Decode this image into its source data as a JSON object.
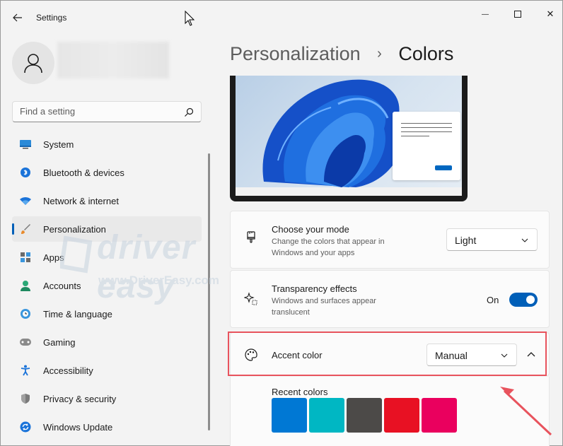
{
  "window": {
    "title": "Settings",
    "minimize_glyph": "—",
    "close_glyph": "✕"
  },
  "search": {
    "placeholder": "Find a setting"
  },
  "sidebar": {
    "items": [
      {
        "label": "System",
        "icon": "system-icon"
      },
      {
        "label": "Bluetooth & devices",
        "icon": "bluetooth-icon"
      },
      {
        "label": "Network & internet",
        "icon": "wifi-icon"
      },
      {
        "label": "Personalization",
        "icon": "brush-icon",
        "active": true
      },
      {
        "label": "Apps",
        "icon": "apps-icon"
      },
      {
        "label": "Accounts",
        "icon": "person-icon"
      },
      {
        "label": "Time & language",
        "icon": "globe-clock-icon"
      },
      {
        "label": "Gaming",
        "icon": "gamepad-icon"
      },
      {
        "label": "Accessibility",
        "icon": "accessibility-icon"
      },
      {
        "label": "Privacy & security",
        "icon": "shield-icon"
      },
      {
        "label": "Windows Update",
        "icon": "update-icon"
      }
    ]
  },
  "breadcrumb": {
    "parent": "Personalization",
    "separator": "›",
    "current": "Colors"
  },
  "settings": {
    "mode": {
      "title": "Choose your mode",
      "description": "Change the colors that appear in Windows and your apps",
      "value": "Light",
      "icon": "brush-icon"
    },
    "transparency": {
      "title": "Transparency effects",
      "description": "Windows and surfaces appear translucent",
      "state_label": "On",
      "enabled": true,
      "icon": "sparkle-icon"
    },
    "accent": {
      "title": "Accent color",
      "value": "Manual",
      "icon": "palette-icon",
      "expanded": true
    }
  },
  "recent_colors": {
    "title": "Recent colors",
    "swatches": [
      "#0078d4",
      "#00b7c3",
      "#4c4a48",
      "#e81123",
      "#ea005e"
    ]
  },
  "watermark": {
    "brand": "driver easy",
    "url": "www.DriverEasy.com"
  },
  "colors": {
    "accent": "#005fb8",
    "highlight": "#e8535d"
  }
}
